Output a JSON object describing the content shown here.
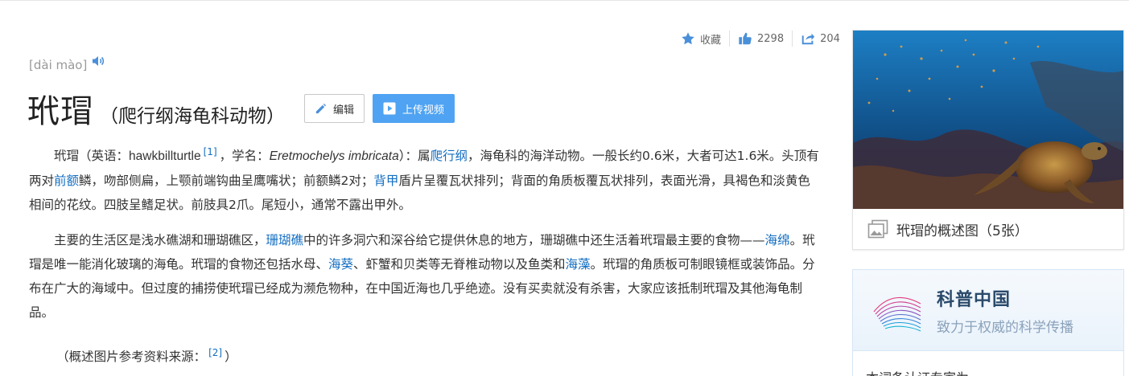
{
  "actions": {
    "favorite_label": "收藏",
    "like_count": "2298",
    "share_count": "204"
  },
  "pronunciation": {
    "pinyin": "[dài mào]"
  },
  "title": {
    "main": "玳瑁",
    "subtitle": "（爬行纲海龟科动物）",
    "edit_label": "编辑",
    "upload_label": "上传视频"
  },
  "summary": {
    "p1": {
      "s1": "玳瑁（英语：",
      "english_name": "hawkbillturtle",
      "ref1": "[1]",
      "s2": "，学名：",
      "sci_name": "Eretmochelys imbricata",
      "s3": "）：属",
      "link_reptilia": "爬行纲",
      "s4": "，海龟科的海洋动物。一般长约0.6米，大者可达1.6米。头顶有两对",
      "link_prefrontal": "前额",
      "s5": "鳞，吻部侧扁，上颚前端钩曲呈鹰嘴状；前额鳞2对；",
      "link_carapace": "背甲",
      "s6": "盾片呈覆瓦状排列；背面的角质板覆瓦状排列，表面光滑，具褐色和淡黄色相间的花纹。四肢呈鳍足状。前肢具2爪。尾短小，通常不露出甲外。"
    },
    "p2": {
      "s1": "主要的生活区是浅水礁湖和珊瑚礁区，",
      "link_coral_reef": "珊瑚礁",
      "s2": "中的许多洞穴和深谷给它提供休息的地方，珊瑚礁中还生活着玳瑁最主要的食物——",
      "link_sponge": "海绵",
      "s3": "。玳瑁是唯一能消化玻璃的海龟。玳瑁的食物还包括水母、",
      "link_anemone": "海葵",
      "s4": "、虾蟹和贝类等无脊椎动物以及鱼类和",
      "link_seaweed": "海藻",
      "s5": "。玳瑁的角质板可制眼镜框或装饰品。分布在广大的海域中。但过度的捕捞使玳瑁已经成为濒危物种，在中国近海也几乎绝迹。没有买卖就没有杀害，大家应该抵制玳瑁及其他海龟制品。"
    },
    "p3": {
      "prefix": "（概述图片参考资料来源：",
      "ref2": "[2]",
      "suffix": "）"
    }
  },
  "album": {
    "caption": "玳瑁的概述图（5张）"
  },
  "kepu": {
    "title": "科普中国",
    "slogan": "致力于权威的科学传播",
    "body": "本词条认证专家为"
  },
  "colors": {
    "link": "#136ec2",
    "upload_button": "#4fa3f2",
    "icon": "#4a90d9"
  }
}
